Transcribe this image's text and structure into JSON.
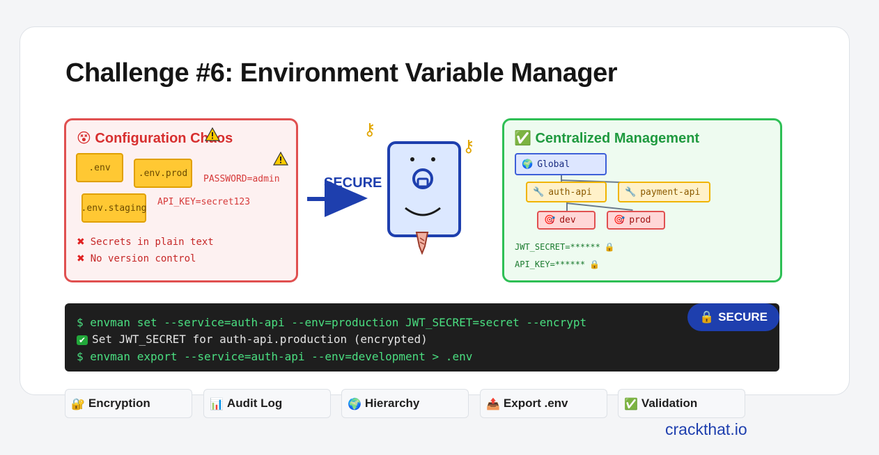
{
  "title": "Challenge #6: Environment Variable Manager",
  "chaos": {
    "emoji": "😵",
    "title": "Configuration Chaos",
    "files": [
      ".env",
      ".env.prod",
      ".env.staging"
    ],
    "secrets": [
      "PASSWORD=admin",
      "API_KEY=secret123"
    ],
    "issues": [
      "Secrets in plain text",
      "No version control"
    ]
  },
  "middle": {
    "label": "SECURE"
  },
  "central": {
    "emoji": "✅",
    "title": "Centralized Management",
    "global": "Global",
    "services": [
      "auth-api",
      "payment-api"
    ],
    "environments": [
      "dev",
      "prod"
    ],
    "secrets": [
      "JWT_SECRET=******",
      "API_KEY=******"
    ]
  },
  "terminal": {
    "lines": [
      "$ envman set --service=auth-api --env=production JWT_SECRET=secret --encrypt",
      "Set JWT_SECRET for auth-api.production (encrypted)",
      "$ envman export --service=auth-api --env=development > .env"
    ],
    "badge": "SECURE"
  },
  "features": [
    {
      "icon": "🔐",
      "label": "Encryption"
    },
    {
      "icon": "📊",
      "label": "Audit Log"
    },
    {
      "icon": "🌍",
      "label": "Hierarchy"
    },
    {
      "icon": "📤",
      "label": "Export .env"
    },
    {
      "icon": "✅",
      "label": "Validation"
    }
  ],
  "brand": "crackthat.io",
  "colors": {
    "accent": "#1e3fae",
    "danger": "#e05050",
    "success": "#2ebf55",
    "warning": "#ffc833"
  }
}
